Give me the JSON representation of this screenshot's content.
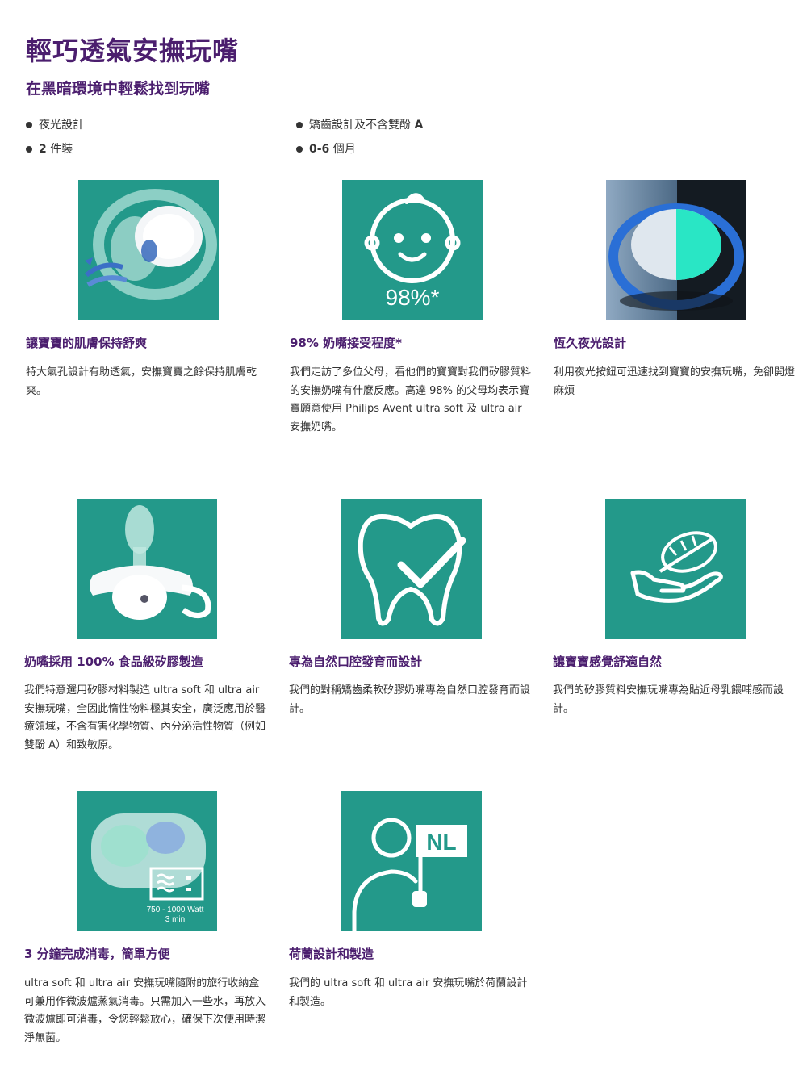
{
  "page": {
    "title": "輕巧透氣安撫玩嘴",
    "subtitle": "在黑暗環境中輕鬆找到玩嘴",
    "colors": {
      "title": "#4b1e6e",
      "teal": "#23998a",
      "text": "#333333"
    }
  },
  "bullets": {
    "left": [
      {
        "text": "夜光設計"
      },
      {
        "prefix": "2",
        "text": " 件裝"
      }
    ],
    "right": [
      {
        "text": "矯齒設計及不含雙酚 ",
        "suffix": "A"
      },
      {
        "prefix": "0-6",
        "text": " 個月"
      }
    ]
  },
  "features": [
    {
      "icon": "pacifier-airflow-image",
      "title": "讓寶寶的肌膚保持舒爽",
      "desc": "特大氣孔設計有助透氣，安撫寶寶之餘保持肌膚乾爽。"
    },
    {
      "icon": "baby-face-icon",
      "badge": "98%*",
      "title_strong": "98%",
      "title": " 奶嘴接受程度*",
      "desc": "我們走訪了多位父母，看他們的寶寶對我們矽膠質料的安撫奶嘴有什麼反應。高達 98% 的父母均表示寶寶願意使用 Philips Avent ultra soft 及 ultra air 安撫奶嘴。"
    },
    {
      "icon": "glow-pacifier-image",
      "title": "恆久夜光設計",
      "desc": "利用夜光按鈕可迅速找到寶寶的安撫玩嘴，免卻開燈麻煩"
    },
    {
      "icon": "silicone-pacifier-image",
      "title_pre": "奶嘴採用 ",
      "title_strong": "100%",
      "title": " 食品級矽膠製造",
      "desc": "我們特意選用矽膠材料製造 ultra soft 和 ultra air 安撫玩嘴，全因此惰性物料極其安全，廣泛應用於醫療領域，不含有害化學物質、內分泌活性物質（例如雙酚 A）和致敏原。"
    },
    {
      "icon": "tooth-check-icon",
      "title": "專為自然口腔發育而設計",
      "desc": "我們的對稱矯齒柔軟矽膠奶嘴專為自然口腔發育而設計。"
    },
    {
      "icon": "hand-feather-icon",
      "title": "讓寶寶感覺舒適自然",
      "desc": "我們的矽膠質料安撫玩嘴專為貼近母乳餵哺感而設計。"
    },
    {
      "icon": "microwave-case-image",
      "caption_line1": "750 - 1000 Watt",
      "caption_line2": "3 min",
      "title_strong": "3",
      "title": " 分鐘完成消毒，簡單方便",
      "desc": "ultra soft 和 ultra air 安撫玩嘴隨附的旅行收納盒可兼用作微波爐蒸氣消毒。只需加入一些水，再放入微波爐即可消毒，令您輕鬆放心，確保下次使用時潔淨無菌。"
    },
    {
      "icon": "person-flag-icon",
      "flag_text": "NL",
      "title": "荷蘭設計和製造",
      "desc": "我們的 ultra soft 和 ultra air 安撫玩嘴於荷蘭設計和製造。"
    }
  ]
}
